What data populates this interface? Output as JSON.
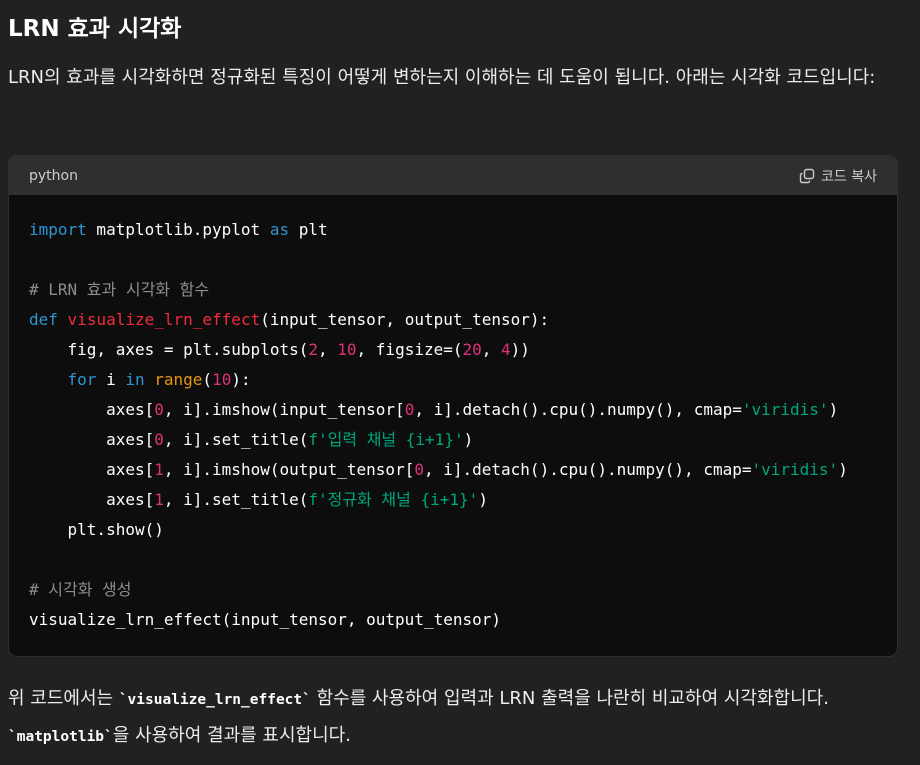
{
  "heading": "LRN 효과 시각화",
  "intro": "LRN의 효과를 시각화하면 정규화된 특징이 어떻게 변하는지 이해하는 데 도움이 됩니다. 아래는 시각화 코드입니다:",
  "code_block": {
    "language": "python",
    "copy_label": "코드 복사",
    "copy_icon": "copy-icon",
    "lines": [
      [
        {
          "t": "import",
          "c": "kw"
        },
        {
          "t": " matplotlib.pyplot "
        },
        {
          "t": "as",
          "c": "kw"
        },
        {
          "t": " plt"
        }
      ],
      [],
      [
        {
          "t": "# LRN 효과 시각화 함수",
          "c": "cm"
        }
      ],
      [
        {
          "t": "def",
          "c": "kw"
        },
        {
          "t": " "
        },
        {
          "t": "visualize_lrn_effect",
          "c": "fn"
        },
        {
          "t": "(input_tensor, output_tensor):"
        }
      ],
      [
        {
          "t": "    fig, axes = plt.subplots("
        },
        {
          "t": "2",
          "c": "num"
        },
        {
          "t": ", "
        },
        {
          "t": "10",
          "c": "num"
        },
        {
          "t": ", figsize=("
        },
        {
          "t": "20",
          "c": "num"
        },
        {
          "t": ", "
        },
        {
          "t": "4",
          "c": "num"
        },
        {
          "t": "))"
        }
      ],
      [
        {
          "t": "    "
        },
        {
          "t": "for",
          "c": "kw"
        },
        {
          "t": " i "
        },
        {
          "t": "in",
          "c": "kw"
        },
        {
          "t": " "
        },
        {
          "t": "range",
          "c": "bi"
        },
        {
          "t": "("
        },
        {
          "t": "10",
          "c": "num"
        },
        {
          "t": "):"
        }
      ],
      [
        {
          "t": "        axes["
        },
        {
          "t": "0",
          "c": "num"
        },
        {
          "t": ", i].imshow(input_tensor["
        },
        {
          "t": "0",
          "c": "num"
        },
        {
          "t": ", i].detach().cpu().numpy(), cmap="
        },
        {
          "t": "'viridis'",
          "c": "str"
        },
        {
          "t": ")"
        }
      ],
      [
        {
          "t": "        axes["
        },
        {
          "t": "0",
          "c": "num"
        },
        {
          "t": ", i].set_title("
        },
        {
          "t": "f'입력 채널 {i+1}'",
          "c": "str"
        },
        {
          "t": ")"
        }
      ],
      [
        {
          "t": "        axes["
        },
        {
          "t": "1",
          "c": "num"
        },
        {
          "t": ", i].imshow(output_tensor["
        },
        {
          "t": "0",
          "c": "num"
        },
        {
          "t": ", i].detach().cpu().numpy(), cmap="
        },
        {
          "t": "'viridis'",
          "c": "str"
        },
        {
          "t": ")"
        }
      ],
      [
        {
          "t": "        axes["
        },
        {
          "t": "1",
          "c": "num"
        },
        {
          "t": ", i].set_title("
        },
        {
          "t": "f'정규화 채널 {i+1}'",
          "c": "str"
        },
        {
          "t": ")"
        }
      ],
      [
        {
          "t": "    plt.show()"
        }
      ],
      [],
      [
        {
          "t": "# 시각화 생성",
          "c": "cm"
        }
      ],
      [
        {
          "t": "visualize_lrn_effect(input_tensor, output_tensor)"
        }
      ]
    ]
  },
  "outro": {
    "part1": "위 코드에서는 ",
    "code1": "`visualize_lrn_effect`",
    "part2": " 함수를 사용하여 입력과 LRN 출력을 나란히 비교하여 시각화합니다. ",
    "code2": "`matplotlib`",
    "part3": "을 사용하여 결과를 표시합니다."
  },
  "colors": {
    "background": "#212121",
    "code_background": "#0d0d0d",
    "code_header": "#2f2f2f",
    "keyword": "#2e95d3",
    "function_name": "#f22c3d",
    "number": "#df3079",
    "string": "#00a67d",
    "builtin": "#e9950c",
    "comment": "#8d8d8d"
  }
}
